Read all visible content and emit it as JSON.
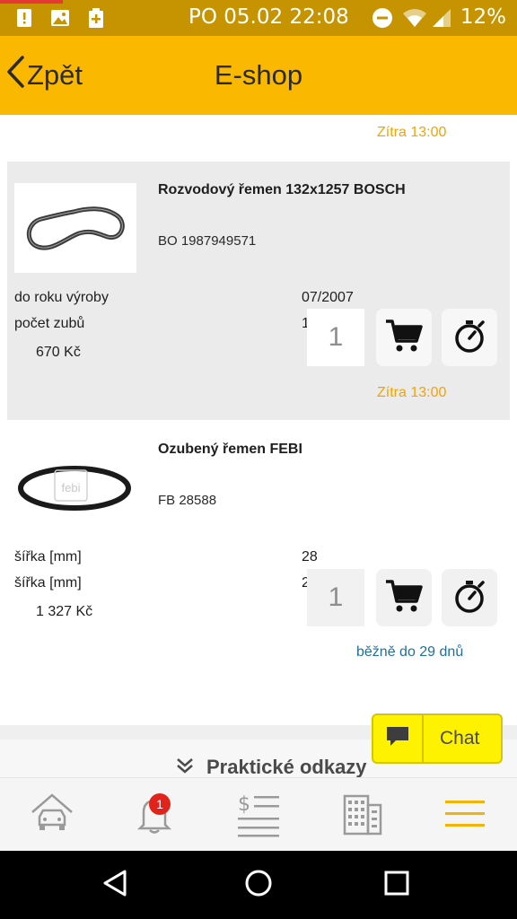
{
  "status_bar": {
    "datetime": "PO 05.02 22:08",
    "battery_level": "12%",
    "icons": [
      "alert-icon",
      "image-icon",
      "battery-plus-icon",
      "do-not-disturb-icon",
      "wifi-icon",
      "signal-icon"
    ]
  },
  "header": {
    "back_label": "Zpět",
    "title": "E-shop"
  },
  "top_eta": "Zítra 13:00",
  "products": [
    {
      "name": "Rozvodový řemen 132x1257 BOSCH",
      "code": "BO 1987949571",
      "attributes": [
        {
          "label": "do roku výroby",
          "value": "07/2007"
        },
        {
          "label": "počet zubů",
          "value": "1"
        }
      ],
      "price": "670 Kč",
      "quantity": "1",
      "delivery": "Zítra 13:00"
    },
    {
      "name": "Ozubený řemen FEBI",
      "code": "FB 28588",
      "attributes": [
        {
          "label": "šířka [mm]",
          "value": "28"
        },
        {
          "label": "šířka [mm]",
          "value": "2"
        }
      ],
      "price": "1 327 Kč",
      "quantity": "1",
      "delivery": "běžně do 29 dnů"
    }
  ],
  "links_section": {
    "label": "Praktické odkazy"
  },
  "chat": {
    "label": "Chat"
  },
  "tab_bar": {
    "notification_count": "1",
    "tabs": [
      "car-icon",
      "bell-icon",
      "price-list-icon",
      "building-icon",
      "menu-icon"
    ]
  },
  "colors": {
    "accent": "#fbb800",
    "status_bar": "#c59400",
    "eta_orange": "#f4a300",
    "eta_blue": "#1f6f9f",
    "chat_yellow": "#fff200",
    "badge_red": "#e0231b"
  }
}
